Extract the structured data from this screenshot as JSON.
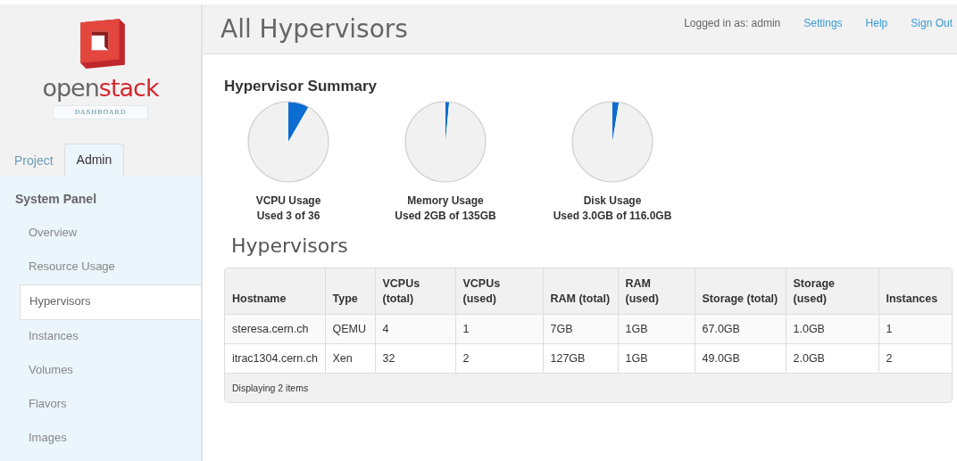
{
  "sidebar": {
    "logo": {
      "text_parts": [
        "open",
        "stack"
      ],
      "subtitle": "DASHBOARD"
    },
    "tabs": [
      {
        "label": "Project",
        "selected": false
      },
      {
        "label": "Admin",
        "selected": true
      }
    ],
    "panel_title": "System Panel",
    "items": [
      {
        "label": "Overview",
        "selected": false
      },
      {
        "label": "Resource Usage",
        "selected": false
      },
      {
        "label": "Hypervisors",
        "selected": true
      },
      {
        "label": "Instances",
        "selected": false
      },
      {
        "label": "Volumes",
        "selected": false
      },
      {
        "label": "Flavors",
        "selected": false
      },
      {
        "label": "Images",
        "selected": false
      }
    ]
  },
  "header": {
    "title": "All Hypervisors",
    "user": "Logged in as: admin",
    "links": [
      "Settings",
      "Help",
      "Sign Out"
    ]
  },
  "summary": {
    "title": "Hypervisor Summary",
    "charts": [
      {
        "label": "VCPU Usage",
        "detail": "Used 3 of 36",
        "chart_data": {
          "type": "pie",
          "values": [
            8.33,
            91.67
          ]
        }
      },
      {
        "label": "Memory Usage",
        "detail": "Used 2GB of 135GB",
        "chart_data": {
          "type": "pie",
          "values": [
            1.48,
            98.52
          ]
        }
      },
      {
        "label": "Disk Usage",
        "detail": "Used 3.0GB of 116.0GB",
        "chart_data": {
          "type": "pie",
          "values": [
            2.59,
            97.41
          ]
        }
      }
    ]
  },
  "table": {
    "title": "Hypervisors",
    "columns": [
      "Hostname",
      "Type",
      "VCPUs (total)",
      "VCPUs (used)",
      "RAM (total)",
      "RAM (used)",
      "Storage (total)",
      "Storage (used)",
      "Instances"
    ],
    "rows": [
      [
        "steresa.cern.ch",
        "QEMU",
        "4",
        "1",
        "7GB",
        "1GB",
        "67.0GB",
        "1.0GB",
        "1"
      ],
      [
        "itrac1304.cern.ch",
        "Xen",
        "32",
        "2",
        "127GB",
        "1GB",
        "49.0GB",
        "2.0GB",
        "2"
      ]
    ],
    "footer": "Displaying 2 items"
  }
}
